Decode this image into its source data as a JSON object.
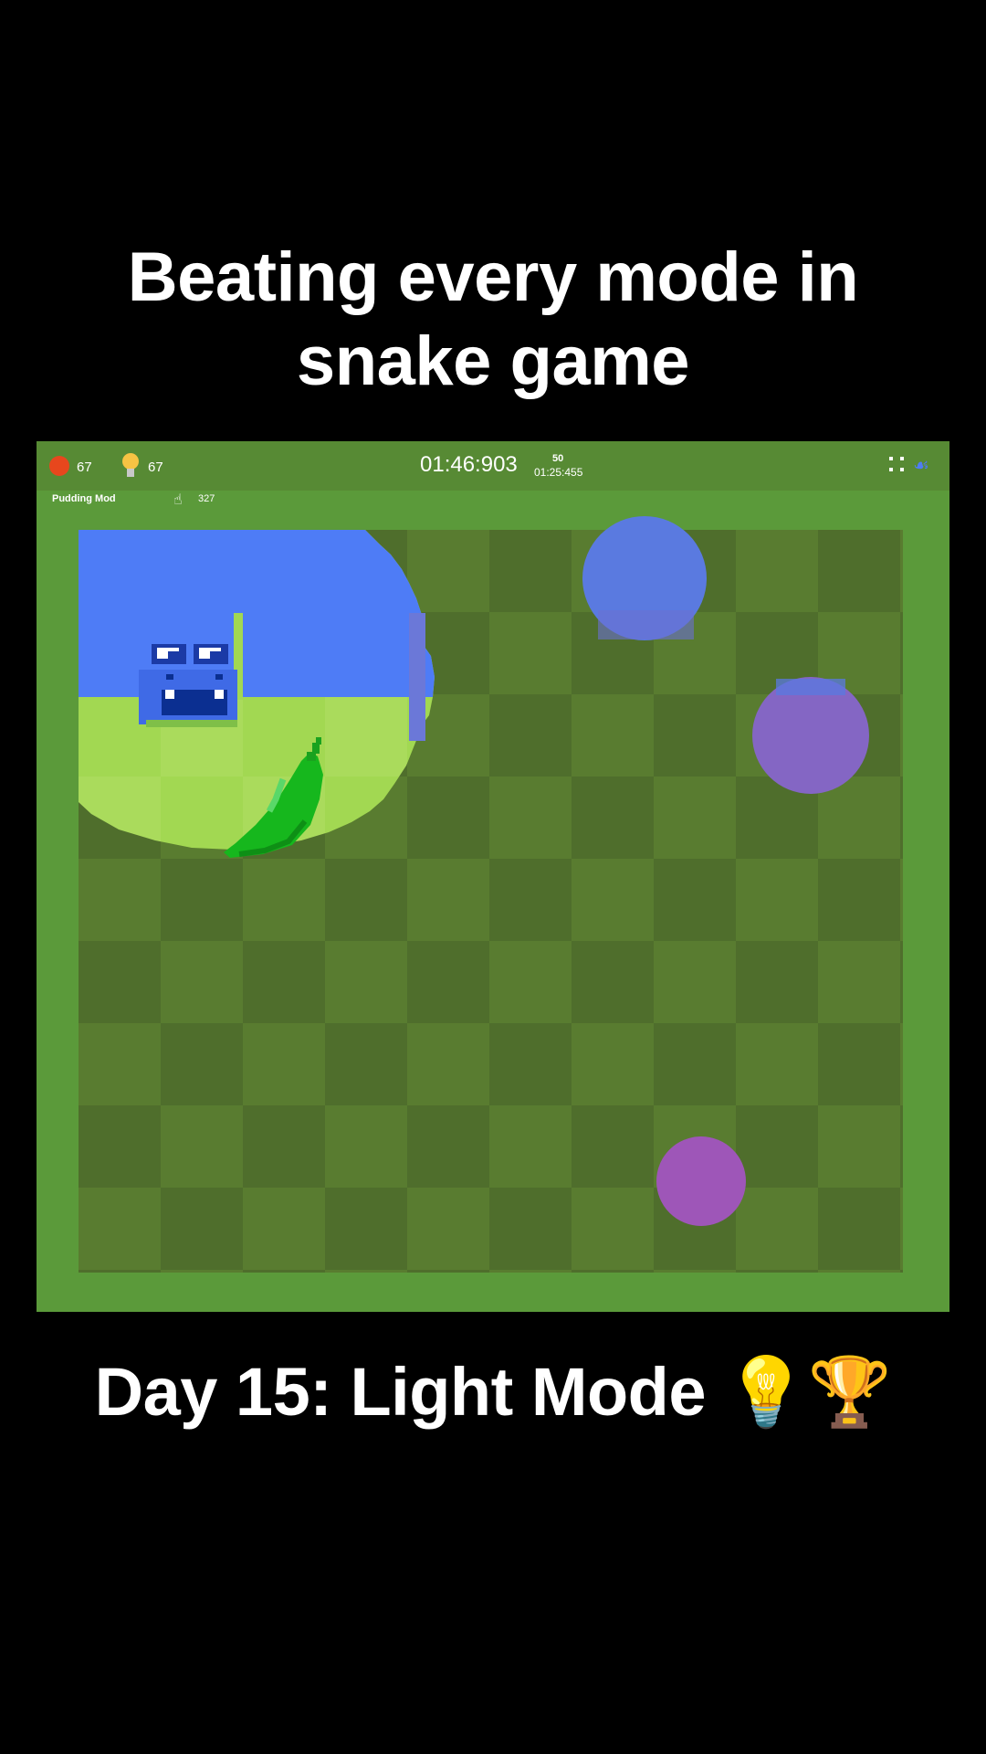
{
  "video": {
    "title_line1": "Beating every mode in",
    "title_line2": "snake game",
    "caption_text": "Day 15: Light Mode",
    "caption_emoji": "💡🏆"
  },
  "hud": {
    "apple_count": "67",
    "bulb_count": "67",
    "timer": "01:46:903",
    "best_count": "50",
    "best_time": "01:25:455",
    "mod_label": "Pudding Mod",
    "cursor_count": "327"
  },
  "icons": {
    "apple": "apple-icon",
    "bulb": "lightbulb-icon",
    "fullscreen": "fullscreen-icon",
    "snake": "snake-icon",
    "cursor": "pointer-icon",
    "pepper": "pepper-icon"
  },
  "colors": {
    "board_dark": "#4f6e2c",
    "board_light": "#597c30",
    "border": "#5b9a3a",
    "snake": "#4e7cf6",
    "lit_area": "#a2d852",
    "pepper": "#16b71d",
    "orb_blue": "#5a7ae0",
    "orb_purple": "#8466c4",
    "orb_magenta": "#9e56b8"
  }
}
